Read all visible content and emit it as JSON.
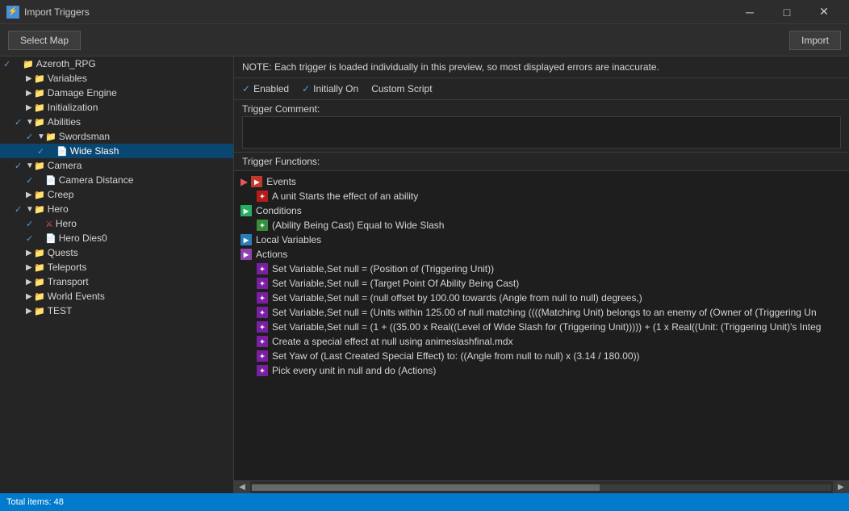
{
  "window": {
    "title": "Import Triggers",
    "icon": "⚡"
  },
  "toolbar": {
    "select_map_label": "Select Map",
    "import_label": "Import"
  },
  "note": {
    "text": "NOTE: Each trigger is loaded individually in this preview, so most displayed errors are inaccurate."
  },
  "checkboxes": {
    "enabled": {
      "checked": true,
      "label": "Enabled"
    },
    "initially_on": {
      "checked": true,
      "label": "Initially On"
    },
    "custom_script": {
      "checked": false,
      "label": "Custom Script"
    }
  },
  "trigger_comment": {
    "label": "Trigger Comment:"
  },
  "trigger_functions": {
    "label": "Trigger Functions:"
  },
  "tree": {
    "items": [
      {
        "level": 0,
        "checked": true,
        "arrow": "",
        "icon": "folder",
        "label": "Azeroth_RPG"
      },
      {
        "level": 1,
        "checked": false,
        "arrow": "▶",
        "icon": "folder",
        "label": "Variables"
      },
      {
        "level": 1,
        "checked": false,
        "arrow": "▶",
        "icon": "folder",
        "label": "Damage Engine"
      },
      {
        "level": 1,
        "checked": false,
        "arrow": "▶",
        "icon": "folder",
        "label": "Initialization"
      },
      {
        "level": 1,
        "checked": true,
        "arrow": "▼",
        "icon": "folder",
        "label": "Abilities"
      },
      {
        "level": 2,
        "checked": true,
        "arrow": "▼",
        "icon": "folder",
        "label": "Swordsman"
      },
      {
        "level": 3,
        "checked": true,
        "arrow": "",
        "icon": "doc",
        "label": "Wide Slash",
        "selected": true
      },
      {
        "level": 1,
        "checked": true,
        "arrow": "▼",
        "icon": "folder",
        "label": "Camera"
      },
      {
        "level": 2,
        "checked": true,
        "arrow": "",
        "icon": "doc",
        "label": "Camera Distance"
      },
      {
        "level": 1,
        "checked": false,
        "arrow": "▶",
        "icon": "folder",
        "label": "Creep"
      },
      {
        "level": 1,
        "checked": true,
        "arrow": "▼",
        "icon": "folder",
        "label": "Hero"
      },
      {
        "level": 2,
        "checked": true,
        "arrow": "",
        "icon": "hero",
        "label": "Hero"
      },
      {
        "level": 2,
        "checked": true,
        "arrow": "",
        "icon": "doc",
        "label": "Hero Dies0"
      },
      {
        "level": 1,
        "checked": false,
        "arrow": "▶",
        "icon": "folder",
        "label": "Quests"
      },
      {
        "level": 1,
        "checked": false,
        "arrow": "▶",
        "icon": "folder",
        "label": "Teleports"
      },
      {
        "level": 1,
        "checked": false,
        "arrow": "▶",
        "icon": "folder",
        "label": "Transport"
      },
      {
        "level": 1,
        "checked": false,
        "arrow": "▶",
        "icon": "folder",
        "label": "World Events"
      },
      {
        "level": 1,
        "checked": false,
        "arrow": "▶",
        "icon": "folder",
        "label": "TEST"
      }
    ]
  },
  "functions": [
    {
      "type": "section",
      "label": "Events",
      "indent": 0
    },
    {
      "type": "item",
      "label": "A unit Starts the effect of an ability",
      "indent": 1
    },
    {
      "type": "section",
      "label": "Conditions",
      "indent": 0
    },
    {
      "type": "item",
      "label": "(Ability Being Cast) Equal to Wide Slash",
      "indent": 1
    },
    {
      "type": "section",
      "label": "Local Variables",
      "indent": 0
    },
    {
      "type": "section",
      "label": "Actions",
      "indent": 0
    },
    {
      "type": "item",
      "label": "Set Variable,Set null = (Position of (Triggering Unit))",
      "indent": 1
    },
    {
      "type": "item",
      "label": "Set Variable,Set null = (Target Point Of Ability Being Cast)",
      "indent": 1
    },
    {
      "type": "item",
      "label": "Set Variable,Set null = (null offset by 100.00 towards (Angle from null to null) degrees,)",
      "indent": 1
    },
    {
      "type": "item",
      "label": "Set Variable,Set null = (Units within 125.00 of null matching ((((Matching Unit) belongs to an enemy of (Owner of (Triggering Un",
      "indent": 1
    },
    {
      "type": "item",
      "label": "Set Variable,Set null = (1 + ((35.00 x Real((Level of Wide Slash for (Triggering Unit))))) + (1 x Real((Unit: (Triggering Unit)'s Integ",
      "indent": 1
    },
    {
      "type": "item",
      "label": "Create a special effect at null using animeslashfinal.mdx",
      "indent": 1
    },
    {
      "type": "item",
      "label": "Set Yaw of (Last Created Special Effect) to: ((Angle from null to null) x (3.14 / 180.00))",
      "indent": 1
    },
    {
      "type": "item",
      "label": "Pick every unit in null and do (Actions)",
      "indent": 1
    }
  ],
  "status": {
    "text": "Total items: 48"
  }
}
